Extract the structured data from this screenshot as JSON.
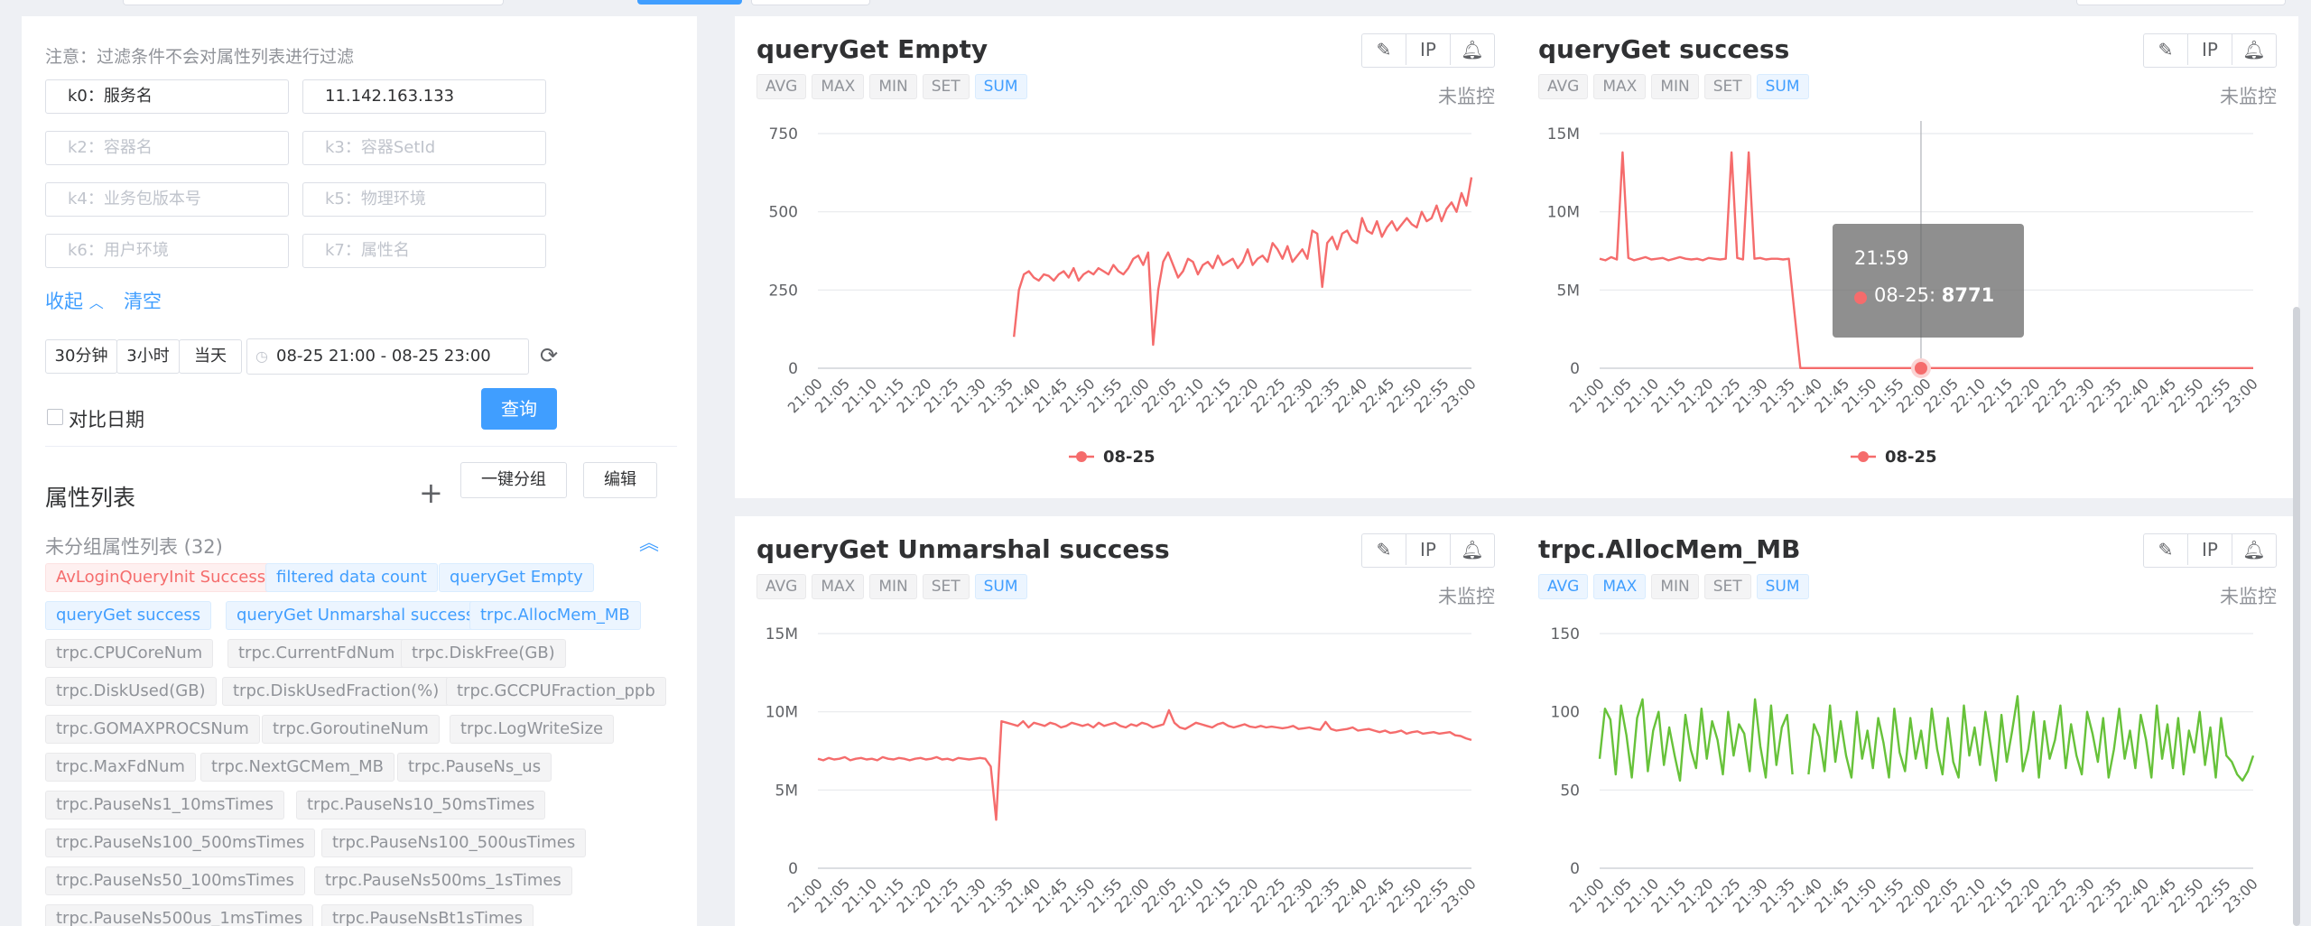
{
  "filter": {
    "note": "注意：过滤条件不会对属性列表进行过滤",
    "fields": [
      {
        "placeholder": "k0：服务名",
        "value": ""
      },
      {
        "placeholder": "",
        "value": "11.142.163.133"
      },
      {
        "placeholder": "k2：容器名",
        "value": ""
      },
      {
        "placeholder": "k3：容器SetId",
        "value": ""
      },
      {
        "placeholder": "k4：业务包版本号",
        "value": ""
      },
      {
        "placeholder": "k5：物理环境",
        "value": ""
      },
      {
        "placeholder": "k6：用户环境",
        "value": ""
      },
      {
        "placeholder": "k7：属性名",
        "value": ""
      }
    ],
    "collapse_label": "收起",
    "clear_label": "清空",
    "time_buttons": [
      "30分钟",
      "3小时",
      "当天"
    ],
    "date_range": "08-25 21:00 - 08-25 23:00",
    "compare_label": "对比日期",
    "query_label": "查询"
  },
  "attributes": {
    "heading": "属性列表",
    "group_button": "一键分组",
    "edit_button": "编辑",
    "ungrouped_label": "未分组属性列表 (32)",
    "tags": [
      {
        "label": "AvLoginQueryInit Success",
        "style": "red"
      },
      {
        "label": "filtered data count",
        "style": "blue"
      },
      {
        "label": "queryGet Empty",
        "style": "blue"
      },
      {
        "label": "queryGet success",
        "style": "blue"
      },
      {
        "label": "queryGet Unmarshal success",
        "style": "blue"
      },
      {
        "label": "trpc.AllocMem_MB",
        "style": "blue"
      },
      {
        "label": "trpc.CPUCoreNum",
        "style": "gray"
      },
      {
        "label": "trpc.CurrentFdNum",
        "style": "gray"
      },
      {
        "label": "trpc.DiskFree(GB)",
        "style": "gray"
      },
      {
        "label": "trpc.DiskUsed(GB)",
        "style": "gray"
      },
      {
        "label": "trpc.DiskUsedFraction(%)",
        "style": "gray"
      },
      {
        "label": "trpc.GCCPUFraction_ppb",
        "style": "gray"
      },
      {
        "label": "trpc.GOMAXPROCSNum",
        "style": "gray"
      },
      {
        "label": "trpc.GoroutineNum",
        "style": "gray"
      },
      {
        "label": "trpc.LogWriteSize",
        "style": "gray"
      },
      {
        "label": "trpc.MaxFdNum",
        "style": "gray"
      },
      {
        "label": "trpc.NextGCMem_MB",
        "style": "gray"
      },
      {
        "label": "trpc.PauseNs_us",
        "style": "gray"
      },
      {
        "label": "trpc.PauseNs1_10msTimes",
        "style": "gray"
      },
      {
        "label": "trpc.PauseNs10_50msTimes",
        "style": "gray"
      },
      {
        "label": "trpc.PauseNs100_500msTimes",
        "style": "gray"
      },
      {
        "label": "trpc.PauseNs100_500usTimes",
        "style": "gray"
      },
      {
        "label": "trpc.PauseNs50_100msTimes",
        "style": "gray"
      },
      {
        "label": "trpc.PauseNs500ms_1sTimes",
        "style": "gray"
      },
      {
        "label": "trpc.PauseNs500us_1msTimes",
        "style": "gray"
      },
      {
        "label": "trpc.PauseNsBt1sTimes",
        "style": "gray"
      }
    ]
  },
  "card_ui": {
    "aggregations": [
      "AVG",
      "MAX",
      "MIN",
      "SET",
      "SUM"
    ],
    "tool_ip": "IP",
    "status": "未监控",
    "colors": {
      "red": "#f56c6c",
      "green": "#67c23a",
      "active": "#409eff"
    }
  },
  "tooltip": {
    "time": "21:59",
    "series": "08-25",
    "value": "8771"
  },
  "chart_data": [
    {
      "type": "line",
      "title": "queryGet Empty",
      "active_aggs": [
        "SUM"
      ],
      "y_ticks": [
        "0",
        "250",
        "500",
        "750"
      ],
      "ylim": [
        0,
        750
      ],
      "x_ticks": [
        "21:00",
        "21:05",
        "21:10",
        "21:15",
        "21:20",
        "21:25",
        "21:30",
        "21:35",
        "21:40",
        "21:45",
        "21:50",
        "21:55",
        "22:00",
        "22:05",
        "22:10",
        "22:15",
        "22:20",
        "22:25",
        "22:30",
        "22:35",
        "22:40",
        "22:45",
        "22:50",
        "22:55",
        "23:00"
      ],
      "legend": [
        "08-25"
      ],
      "color": "#f56c6c",
      "series": [
        {
          "name": "08-25",
          "x_start": 36,
          "values": [
            100,
            250,
            300,
            310,
            290,
            280,
            300,
            295,
            280,
            300,
            310,
            290,
            320,
            280,
            300,
            310,
            300,
            320,
            310,
            300,
            330,
            310,
            300,
            320,
            350,
            360,
            330,
            370,
            75,
            250,
            340,
            370,
            330,
            290,
            310,
            350,
            340,
            300,
            330,
            340,
            320,
            360,
            330,
            340,
            350,
            320,
            340,
            380,
            330,
            350,
            360,
            340,
            400,
            380,
            350,
            390,
            340,
            360,
            380,
            350,
            440,
            430,
            260,
            400,
            420,
            380,
            430,
            440,
            410,
            400,
            480,
            440,
            430,
            470,
            420,
            450,
            470,
            440,
            460,
            480,
            460,
            450,
            500,
            470,
            480,
            520,
            470,
            510,
            530,
            500,
            560,
            520,
            610
          ]
        }
      ]
    },
    {
      "type": "line",
      "title": "queryGet success",
      "active_aggs": [
        "SUM"
      ],
      "y_ticks": [
        "0",
        "5M",
        "10M",
        "15M"
      ],
      "ylim": [
        0,
        15000000
      ],
      "x_ticks": [
        "21:00",
        "21:05",
        "21:10",
        "21:15",
        "21:20",
        "21:25",
        "21:30",
        "21:35",
        "21:40",
        "21:45",
        "21:50",
        "21:55",
        "22:00",
        "22:05",
        "22:10",
        "22:15",
        "22:20",
        "22:25",
        "22:30",
        "22:35",
        "22:40",
        "22:45",
        "22:50",
        "22:55",
        "23:00"
      ],
      "legend": [
        "08-25"
      ],
      "color": "#f56c6c",
      "series": [
        {
          "name": "08-25",
          "x_start": 0,
          "values": [
            7000000,
            6900000,
            7100000,
            6950000,
            13800000,
            7050000,
            6900000,
            7000000,
            7100000,
            6950000,
            7000000,
            7050000,
            6900000,
            7000000,
            7100000,
            7000000,
            6950000,
            7000000,
            6900000,
            7050000,
            7000000,
            6950000,
            7000000,
            13800000,
            7050000,
            6950000,
            13800000,
            7000000,
            7050000,
            6950000,
            7000000,
            7000000,
            6950000,
            7000000,
            3500000,
            8771,
            8771,
            8771,
            8771,
            8771,
            8771,
            8771,
            8771,
            8771,
            8771,
            8771,
            8771,
            8771,
            8771,
            8771,
            8771,
            8771,
            8771,
            8771,
            8771,
            8771,
            8771,
            8771,
            8771,
            8771,
            8771,
            8771,
            8771,
            8771,
            8771,
            8771,
            8771,
            8771,
            8771,
            8771,
            8771,
            8771,
            8771,
            8771,
            8771,
            8771,
            8771,
            8771,
            8771,
            8771,
            8771,
            8771,
            8771,
            8771,
            8771,
            8771,
            8771,
            8771,
            8771,
            8771,
            8771,
            8771,
            8771,
            8771,
            8771,
            8771,
            8771,
            8771,
            8771,
            8771,
            8771,
            8771,
            8771,
            8771,
            8771,
            8771,
            8771,
            8771,
            8771,
            8771,
            8771,
            8771,
            8771,
            8771,
            8771
          ]
        }
      ]
    },
    {
      "type": "line",
      "title": "queryGet Unmarshal success",
      "active_aggs": [
        "SUM"
      ],
      "y_ticks": [
        "0",
        "5M",
        "10M",
        "15M"
      ],
      "ylim": [
        0,
        15000000
      ],
      "x_ticks": [
        "21:00",
        "21:05",
        "21:10",
        "21:15",
        "21:20",
        "21:25",
        "21:30",
        "21:35",
        "21:40",
        "21:45",
        "21:50",
        "21:55",
        "22:00",
        "22:05",
        "22:10",
        "22:15",
        "22:20",
        "22:25",
        "22:30",
        "22:35",
        "22:40",
        "22:45",
        "22:50",
        "22:55",
        "23:00"
      ],
      "legend": [
        "08-25"
      ],
      "color": "#f56c6c",
      "series": [
        {
          "name": "08-25",
          "x_start": 0,
          "values": [
            7000000,
            6900000,
            7050000,
            6950000,
            7000000,
            7100000,
            6900000,
            7000000,
            7050000,
            6950000,
            7000000,
            6900000,
            7100000,
            7000000,
            6950000,
            7050000,
            7000000,
            6900000,
            7000000,
            7050000,
            6950000,
            7000000,
            7100000,
            6950000,
            7000000,
            6900000,
            7050000,
            7000000,
            6950000,
            7000000,
            7050000,
            7000000,
            6500000,
            3100000,
            9400000,
            9300000,
            9200000,
            9100000,
            9400000,
            9000000,
            9300000,
            9200000,
            9100000,
            9300000,
            9200000,
            9000000,
            9100000,
            9300000,
            9200000,
            9100000,
            9200000,
            9000000,
            9300000,
            9100000,
            9200000,
            9300000,
            9100000,
            9000000,
            9200000,
            9100000,
            9300000,
            9200000,
            9000000,
            9100000,
            9200000,
            10100000,
            9300000,
            9000000,
            8900000,
            9100000,
            9300000,
            9200000,
            9100000,
            9000000,
            9200000,
            9300000,
            9100000,
            9000000,
            9100000,
            9200000,
            9050000,
            9000000,
            9100000,
            9000000,
            9050000,
            9000000,
            8950000,
            9000000,
            9100000,
            8900000,
            8950000,
            9000000,
            8900000,
            8850000,
            9350000,
            8900000,
            8800000,
            8850000,
            8900000,
            9000000,
            8800000,
            8850000,
            8900000,
            8800000,
            8700000,
            8800000,
            8650000,
            8700000,
            8800000,
            8600000,
            8700000,
            8750000,
            8600000,
            8650000,
            8700000,
            8600000,
            8650000,
            8700000,
            8500000,
            8450000,
            8300000,
            8200000
          ]
        }
      ]
    },
    {
      "type": "line",
      "title": "trpc.AllocMem_MB",
      "active_aggs": [
        "AVG",
        "MAX",
        "SUM"
      ],
      "y_ticks": [
        "0",
        "50",
        "100",
        "150"
      ],
      "ylim": [
        0,
        150
      ],
      "x_ticks": [
        "21:00",
        "21:05",
        "21:10",
        "21:15",
        "21:20",
        "21:25",
        "21:30",
        "21:35",
        "21:40",
        "21:45",
        "21:50",
        "21:55",
        "22:00",
        "22:05",
        "22:10",
        "22:15",
        "22:20",
        "22:25",
        "22:30",
        "22:35",
        "22:40",
        "22:45",
        "22:50",
        "22:55",
        "23:00"
      ],
      "legend": [],
      "color": "#67c23a",
      "series": [
        {
          "name": "",
          "x_start": 0,
          "gap": [
            36,
            38
          ],
          "values": [
            70,
            102,
            95,
            60,
            104,
            85,
            58,
            96,
            108,
            62,
            88,
            100,
            66,
            90,
            72,
            56,
            98,
            76,
            64,
            102,
            70,
            94,
            82,
            60,
            100,
            72,
            92,
            86,
            62,
            108,
            78,
            58,
            104,
            66,
            90,
            98,
            60,
            null,
            null,
            60,
            92,
            84,
            62,
            104,
            68,
            94,
            72,
            58,
            100,
            70,
            88,
            64,
            96,
            80,
            58,
            102,
            74,
            62,
            96,
            70,
            88,
            64,
            102,
            76,
            60,
            96,
            68,
            58,
            104,
            72,
            90,
            66,
            100,
            78,
            56,
            98,
            68,
            88,
            110,
            62,
            76,
            100,
            58,
            94,
            70,
            82,
            104,
            64,
            92,
            72,
            60,
            100,
            86,
            68,
            96,
            58,
            76,
            102,
            70,
            88,
            64,
            98,
            82,
            58,
            104,
            70,
            92,
            64,
            96,
            60,
            88,
            74,
            100,
            66,
            90,
            58,
            96,
            72,
            68,
            60,
            56,
            62,
            72
          ]
        }
      ]
    }
  ]
}
